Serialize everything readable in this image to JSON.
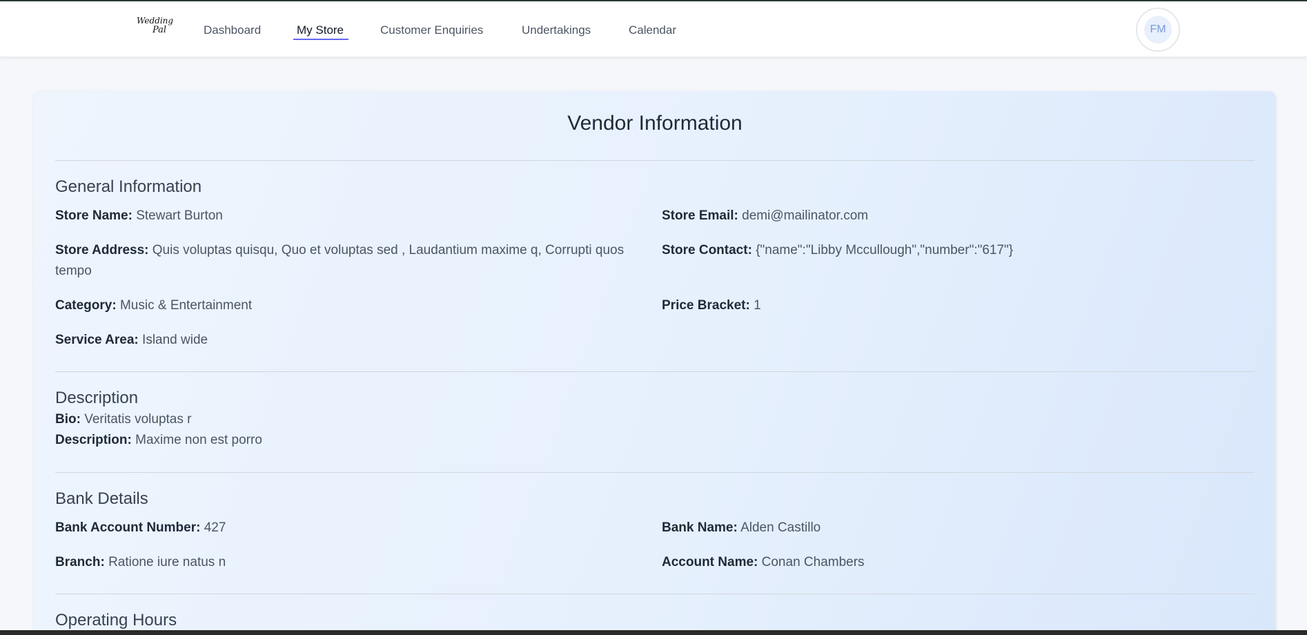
{
  "logo": {
    "line1": "Wedding",
    "line2": "Pal"
  },
  "nav": {
    "items": [
      "Dashboard",
      "My Store",
      "Customer Enquiries",
      "Undertakings",
      "Calendar"
    ],
    "active": "My Store"
  },
  "user": {
    "initials": "FM"
  },
  "page": {
    "title": "Vendor Information"
  },
  "general": {
    "title": "General Information",
    "store_name": {
      "label": "Store Name:",
      "value": "Stewart Burton"
    },
    "store_email": {
      "label": "Store Email:",
      "value": "demi@mailinator.com"
    },
    "store_address": {
      "label": "Store Address:",
      "value": "Quis voluptas quisqu, Quo et voluptas sed , Laudantium maxime q, Corrupti quos tempo"
    },
    "store_contact": {
      "label": "Store Contact:",
      "value": "{\"name\":\"Libby Mccullough\",\"number\":\"617\"}"
    },
    "category": {
      "label": "Category:",
      "value": "Music & Entertainment"
    },
    "price_bracket": {
      "label": "Price Bracket:",
      "value": "1"
    },
    "service_area": {
      "label": "Service Area:",
      "value": "Island wide"
    }
  },
  "description": {
    "title": "Description",
    "bio": {
      "label": "Bio:",
      "value": "Veritatis voluptas r"
    },
    "description": {
      "label": "Description:",
      "value": "Maxime non est porro"
    }
  },
  "bank": {
    "title": "Bank Details",
    "account_number": {
      "label": "Bank Account Number:",
      "value": "427"
    },
    "bank_name": {
      "label": "Bank Name:",
      "value": "Alden Castillo"
    },
    "branch": {
      "label": "Branch:",
      "value": "Ratione iure natus n"
    },
    "account_name": {
      "label": "Account Name:",
      "value": "Conan Chambers"
    }
  },
  "hours": {
    "title": "Operating Hours"
  }
}
